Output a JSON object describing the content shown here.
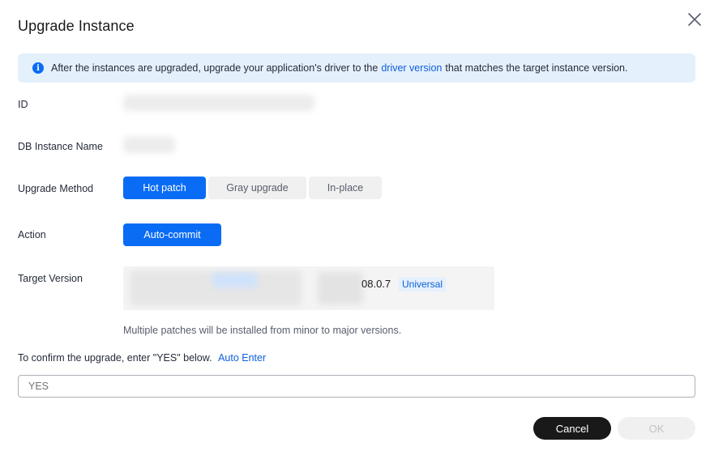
{
  "dialog": {
    "title": "Upgrade Instance",
    "close_icon": "close-icon"
  },
  "alert": {
    "icon": "info-icon",
    "icon_glyph": "i",
    "text_before": "After the instances are upgraded, upgrade your application's driver to the",
    "link": "driver version",
    "text_after": "that matches the target instance version."
  },
  "fields": {
    "id_label": "ID",
    "name_label": "DB Instance Name",
    "method_label": "Upgrade Method",
    "action_label": "Action",
    "target_label": "Target Version"
  },
  "upgrade_methods": [
    {
      "label": "Hot patch",
      "selected": true
    },
    {
      "label": "Gray upgrade",
      "selected": false
    },
    {
      "label": "In-place",
      "selected": false
    }
  ],
  "action": {
    "label": "Auto-commit",
    "selected": true
  },
  "target_version": {
    "version": "08.0.7",
    "badge": "Universal"
  },
  "hint": "Multiple patches will be installed from minor to major versions.",
  "confirm": {
    "text": "To confirm the upgrade, enter \"YES\" below.",
    "auto_link": "Auto Enter",
    "placeholder": "YES",
    "value": ""
  },
  "footer": {
    "cancel_label": "Cancel",
    "ok_label": "OK"
  },
  "colors": {
    "primary": "#0a6cf5",
    "alert_bg": "#e5f0fd",
    "link": "#0d5fd9",
    "dark_button": "#191919"
  }
}
